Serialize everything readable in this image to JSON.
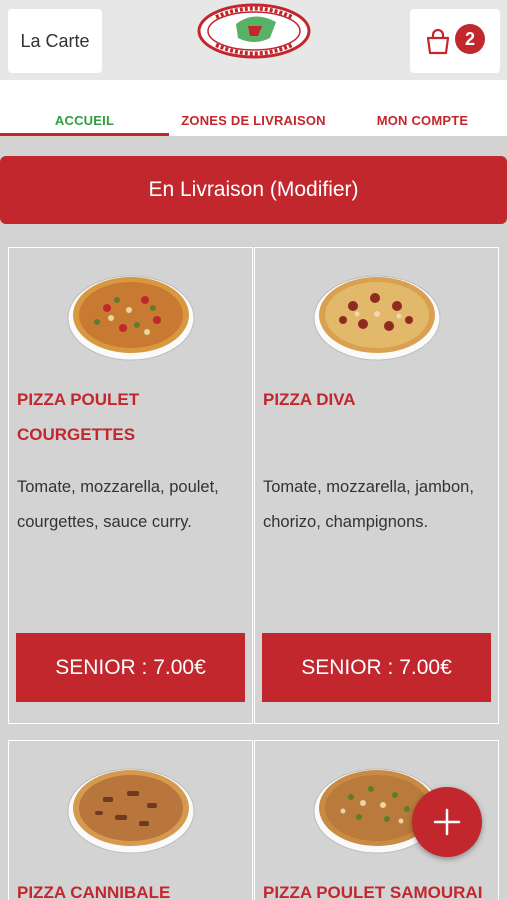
{
  "header": {
    "menu_button_label": "La Carte",
    "cart_count": "2",
    "logo_alt": "Italy Food pizzeria logo"
  },
  "tabs": [
    {
      "label": "ACCUEIL",
      "active": true
    },
    {
      "label": "ZONES DE LIVRAISON",
      "active": false
    },
    {
      "label": "MON COMPTE",
      "active": false
    }
  ],
  "delivery_banner": "En Livraison (Modifier)",
  "products": [
    {
      "name": "PIZZA POULET COURGETTES",
      "description": "Tomate, mozzarella, poulet, courgettes, sauce curry.",
      "price_label": "SENIOR : 7.00€"
    },
    {
      "name": "PIZZA DIVA",
      "description": "Tomate, mozzarella, jambon, chorizo, champignons.",
      "price_label": "SENIOR : 7.00€"
    },
    {
      "name": "PIZZA CANNIBALE",
      "description": "",
      "price_label": ""
    },
    {
      "name": "PIZZA POULET SAMOURAI",
      "description": "",
      "price_label": ""
    }
  ],
  "colors": {
    "brand": "#c1272d",
    "active_tab": "#2e9e3e",
    "background": "#d3d3d3"
  },
  "icons": {
    "cart": "shopping-bag-icon",
    "fab": "plus-icon"
  }
}
